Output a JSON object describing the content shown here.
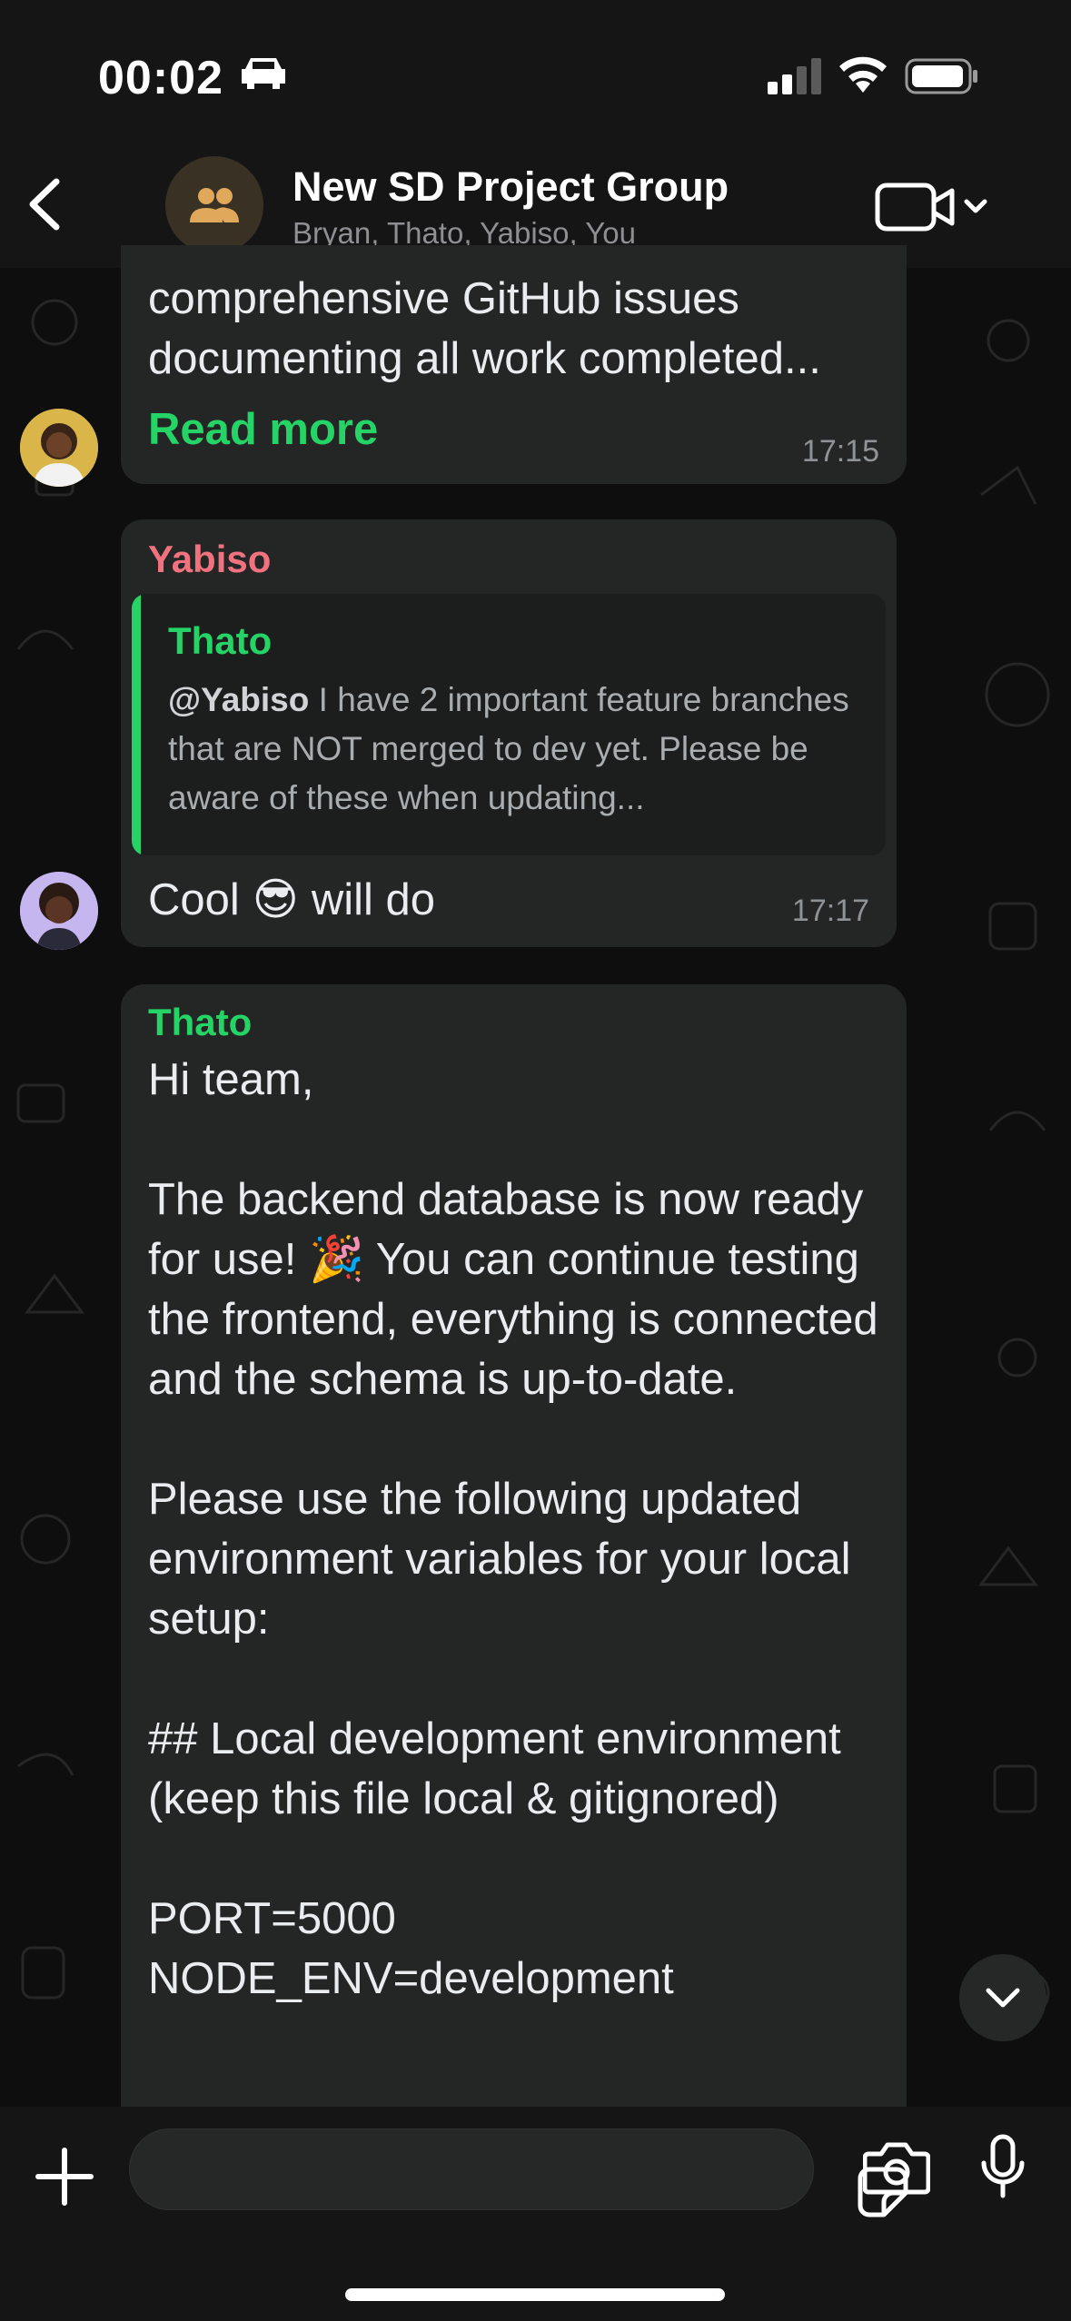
{
  "status_bar": {
    "time": "00:02"
  },
  "header": {
    "title": "New SD Project Group",
    "members": "Bryan, Thato, Yabiso, You"
  },
  "messages": [
    {
      "text": "comprehensive GitHub issues documenting all work completed...",
      "read_more": "Read more",
      "time": "17:15"
    },
    {
      "sender": "Yabiso",
      "sender_color": "#f0727e",
      "quote": {
        "sender": "Thato",
        "mention": "@Yabiso",
        "text": " I have 2 important feature branches that are NOT merged to dev yet. Please be aware of these when updating..."
      },
      "text_before": "Cool",
      "emoji": "😎",
      "text_after": "will do",
      "time": "17:17"
    },
    {
      "sender": "Thato",
      "sender_color": "#25d366",
      "lines": [
        "Hi team,",
        "",
        "The backend database is now ready for use! 🎉 You can continue testing the frontend, everything is connected and the schema is up-to-date.",
        "",
        "Please use the following updated environment variables for your local setup:",
        "",
        "## Local development environment (keep this file local & gitignored)",
        "",
        "PORT=5000",
        "NODE_ENV=development"
      ]
    }
  ],
  "composer": {
    "placeholder": ""
  },
  "colors": {
    "accent": "#25d366",
    "bubble": "#242626",
    "background": "#0e0e0e"
  },
  "icons": [
    "back-icon",
    "group-icon",
    "video-call-icon",
    "chevron-down-icon",
    "plus-icon",
    "sticker-icon",
    "camera-icon",
    "microphone-icon",
    "car-icon",
    "signal-icon",
    "wifi-icon",
    "battery-icon"
  ]
}
